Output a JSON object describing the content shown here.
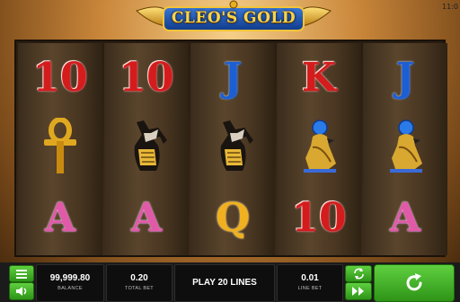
{
  "clock": "11:0",
  "game": {
    "title": "CLEO'S GOLD"
  },
  "reels": [
    {
      "symbols": [
        {
          "kind": "letter",
          "text": "10",
          "color": "red"
        },
        {
          "kind": "icon",
          "icon": "ankh-icon"
        },
        {
          "kind": "letter",
          "text": "A",
          "color": "pink"
        }
      ]
    },
    {
      "symbols": [
        {
          "kind": "letter",
          "text": "10",
          "color": "red"
        },
        {
          "kind": "icon",
          "icon": "anubis-icon"
        },
        {
          "kind": "letter",
          "text": "A",
          "color": "pink"
        }
      ]
    },
    {
      "symbols": [
        {
          "kind": "letter",
          "text": "J",
          "color": "blue"
        },
        {
          "kind": "icon",
          "icon": "anubis-icon"
        },
        {
          "kind": "letter",
          "text": "Q",
          "color": "gold"
        }
      ]
    },
    {
      "symbols": [
        {
          "kind": "letter",
          "text": "K",
          "color": "red"
        },
        {
          "kind": "icon",
          "icon": "falcon-icon"
        },
        {
          "kind": "letter",
          "text": "10",
          "color": "red"
        }
      ]
    },
    {
      "symbols": [
        {
          "kind": "letter",
          "text": "J",
          "color": "blue"
        },
        {
          "kind": "icon",
          "icon": "falcon-icon"
        },
        {
          "kind": "letter",
          "text": "A",
          "color": "pink"
        }
      ]
    }
  ],
  "controls": {
    "balance": {
      "value": "99,999.80",
      "label": "BALANCE"
    },
    "total_bet": {
      "value": "0.20",
      "label": "TOTAL BET"
    },
    "play_lines": "PLAY 20 LINES",
    "line_bet": {
      "value": "0.01",
      "label": "LINE BET"
    }
  },
  "colors": {
    "accent_green": "#3cb52a",
    "bar": "#1b1b1b",
    "gold": "#f8d44a"
  }
}
